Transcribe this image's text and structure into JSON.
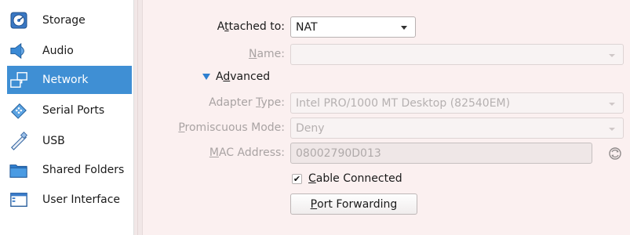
{
  "sidebar": {
    "items": [
      {
        "label": "Storage",
        "icon": "storage-icon",
        "active": false
      },
      {
        "label": "Audio",
        "icon": "audio-icon",
        "active": false
      },
      {
        "label": "Network",
        "icon": "network-icon",
        "active": true
      },
      {
        "label": "Serial Ports",
        "icon": "serial-ports-icon",
        "active": false
      },
      {
        "label": "USB",
        "icon": "usb-icon",
        "active": false
      },
      {
        "label": "Shared Folders",
        "icon": "shared-folders-icon",
        "active": false
      },
      {
        "label": "User Interface",
        "icon": "user-interface-icon",
        "active": false
      }
    ],
    "active_color": "#3f8fd4"
  },
  "network": {
    "attached_to": {
      "label_pre": "A",
      "label_u": "t",
      "label_post": "tached to:",
      "value": "NAT"
    },
    "name": {
      "label_u": "N",
      "label_post": "ame:",
      "value": ""
    },
    "advanced": {
      "label_pre": "A",
      "label_u": "d",
      "label_post": "vanced"
    },
    "adapter_type": {
      "label_pre": "Adapter ",
      "label_u": "T",
      "label_post": "ype:",
      "value": "Intel PRO/1000 MT Desktop (82540EM)"
    },
    "promiscuous_mode": {
      "label_u": "P",
      "label_post": "romiscuous Mode:",
      "value": "Deny"
    },
    "mac_address": {
      "label_u": "M",
      "label_post": "AC Address:",
      "value": "08002790D013"
    },
    "cable_connected": {
      "checked": true,
      "check_glyph": "✔",
      "label_u": "C",
      "label_post": "able Connected"
    },
    "port_forwarding": {
      "label_u": "P",
      "label_post": "ort Forwarding"
    }
  }
}
